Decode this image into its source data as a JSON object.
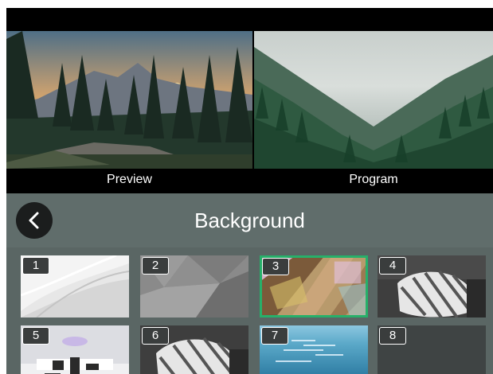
{
  "monitors": {
    "preview_label": "Preview",
    "program_label": "Program"
  },
  "background_panel": {
    "title": "Background",
    "back_icon": "chevron-left-icon",
    "selected_color": "#27b06a",
    "tiles": [
      {
        "number": "1",
        "thumbnail": "white-drapery",
        "selected": false
      },
      {
        "number": "2",
        "thumbnail": "gray-polygon",
        "selected": false
      },
      {
        "number": "3",
        "thumbnail": "colorful-wood",
        "selected": true
      },
      {
        "number": "4",
        "thumbnail": "striped-pillow",
        "selected": false
      },
      {
        "number": "5",
        "thumbnail": "white-studio",
        "selected": false
      },
      {
        "number": "6",
        "thumbnail": "striped-pillow",
        "selected": false
      },
      {
        "number": "7",
        "thumbnail": "blue-sea",
        "selected": false
      },
      {
        "number": "8",
        "thumbnail": "empty",
        "selected": false
      }
    ]
  }
}
